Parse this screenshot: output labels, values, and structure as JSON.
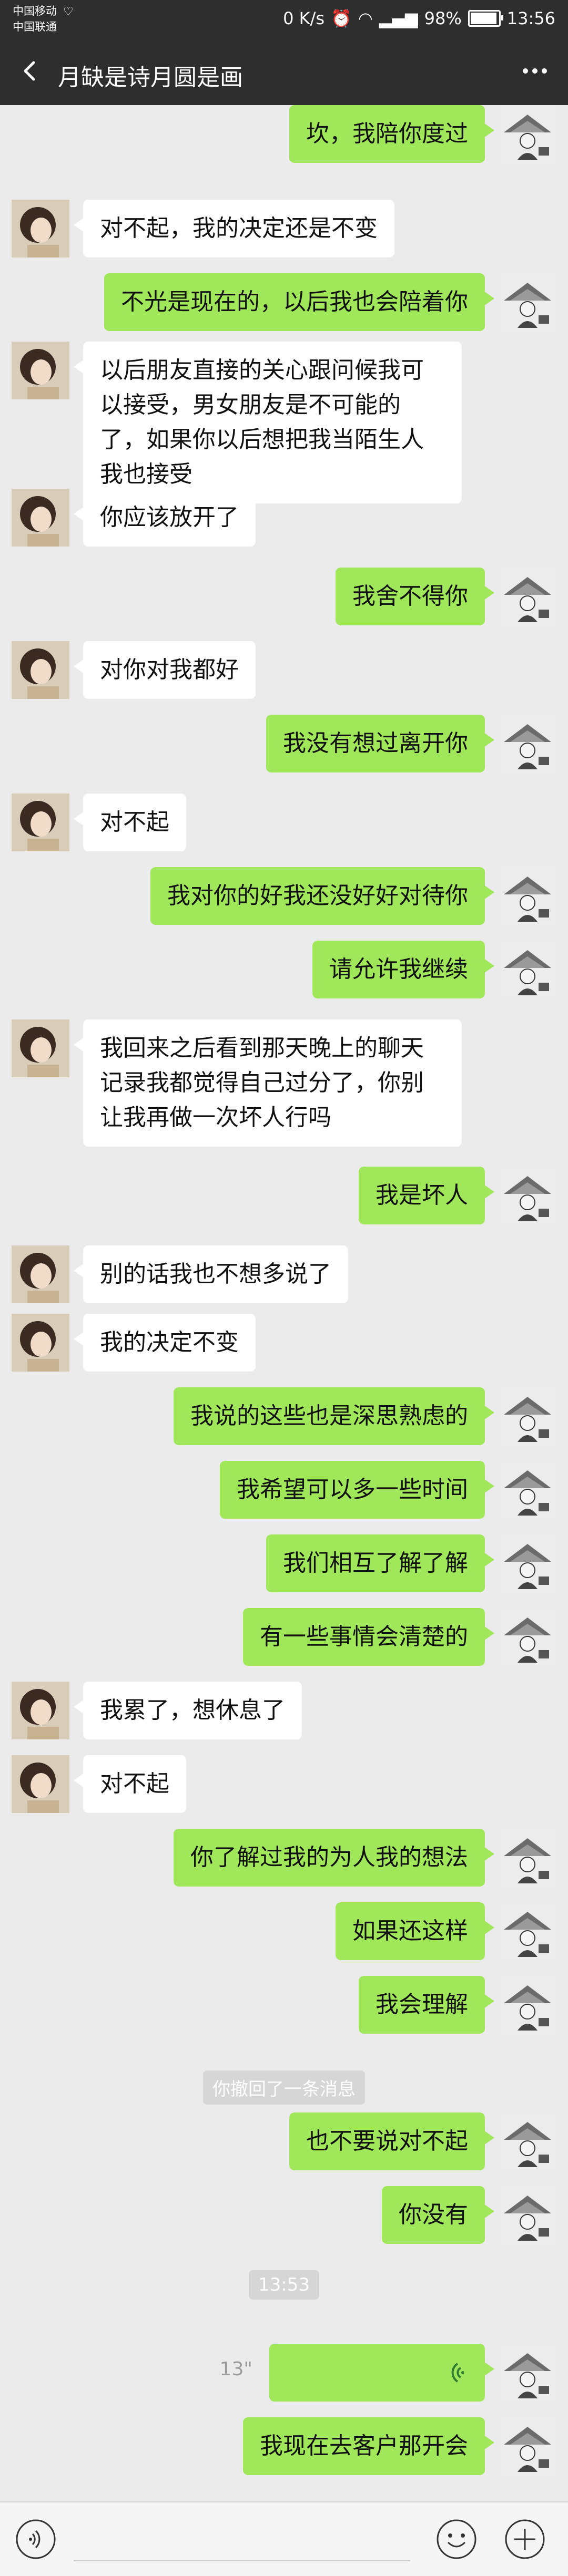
{
  "status_bar": {
    "carrier1": "中国移动",
    "carrier2": "中国联通",
    "network_speed": "0 K/s",
    "battery": "98%",
    "battery_level": 0.98,
    "time": "13:56"
  },
  "header": {
    "title": "月缺是诗月圆是画"
  },
  "messages": [
    {
      "from": "me",
      "text": "坎，我陪你度过"
    },
    {
      "from": "other",
      "text": "对不起，我的决定还是不变"
    },
    {
      "from": "me",
      "text": "不光是现在的，以后我也会陪着你"
    },
    {
      "from": "other",
      "text": "以后朋友直接的关心跟问候我可以接受，男女朋友是不可能的了，如果你以后想把我当陌生人我也接受"
    },
    {
      "from": "other",
      "text": "你应该放开了"
    },
    {
      "from": "me",
      "text": "我舍不得你"
    },
    {
      "from": "other",
      "text": "对你对我都好"
    },
    {
      "from": "me",
      "text": "我没有想过离开你"
    },
    {
      "from": "other",
      "text": "对不起"
    },
    {
      "from": "me",
      "text": "我对你的好我还没好好对待你"
    },
    {
      "from": "me",
      "text": "请允许我继续"
    },
    {
      "from": "other",
      "text": "我回来之后看到那天晚上的聊天记录我都觉得自己过分了，你别让我再做一次坏人行吗"
    },
    {
      "from": "me",
      "text": "我是坏人"
    },
    {
      "from": "other",
      "text": "别的话我也不想多说了"
    },
    {
      "from": "other",
      "text": "我的决定不变"
    },
    {
      "from": "me",
      "text": "我说的这些也是深思熟虑的"
    },
    {
      "from": "me",
      "text": "我希望可以多一些时间"
    },
    {
      "from": "me",
      "text": "我们相互了解了解"
    },
    {
      "from": "me",
      "text": "有一些事情会清楚的"
    },
    {
      "from": "other",
      "text": "我累了，想休息了"
    },
    {
      "from": "other",
      "text": "对不起"
    },
    {
      "from": "me",
      "text": "你了解过我的为人我的想法"
    },
    {
      "from": "me",
      "text": "如果还这样"
    },
    {
      "from": "me",
      "text": "我会理解"
    },
    {
      "from": "system",
      "text": "你撤回了一条消息"
    },
    {
      "from": "me",
      "text": "也不要说对不起"
    },
    {
      "from": "me",
      "text": "你没有"
    },
    {
      "from": "system",
      "text": "13:53"
    },
    {
      "from": "me",
      "type": "voice",
      "duration": "13\""
    },
    {
      "from": "me",
      "text": "我现在去客户那开会"
    }
  ],
  "icons": {
    "back": "back-arrow-icon",
    "more": "more-dots-icon",
    "voice": "voice-input-icon",
    "emoji": "emoji-icon",
    "add": "add-icon"
  },
  "colors": {
    "header_bg": "#2e2e2e",
    "chat_bg": "#ebebeb",
    "my_bubble": "#a0e75a",
    "their_bubble": "#ffffff"
  }
}
